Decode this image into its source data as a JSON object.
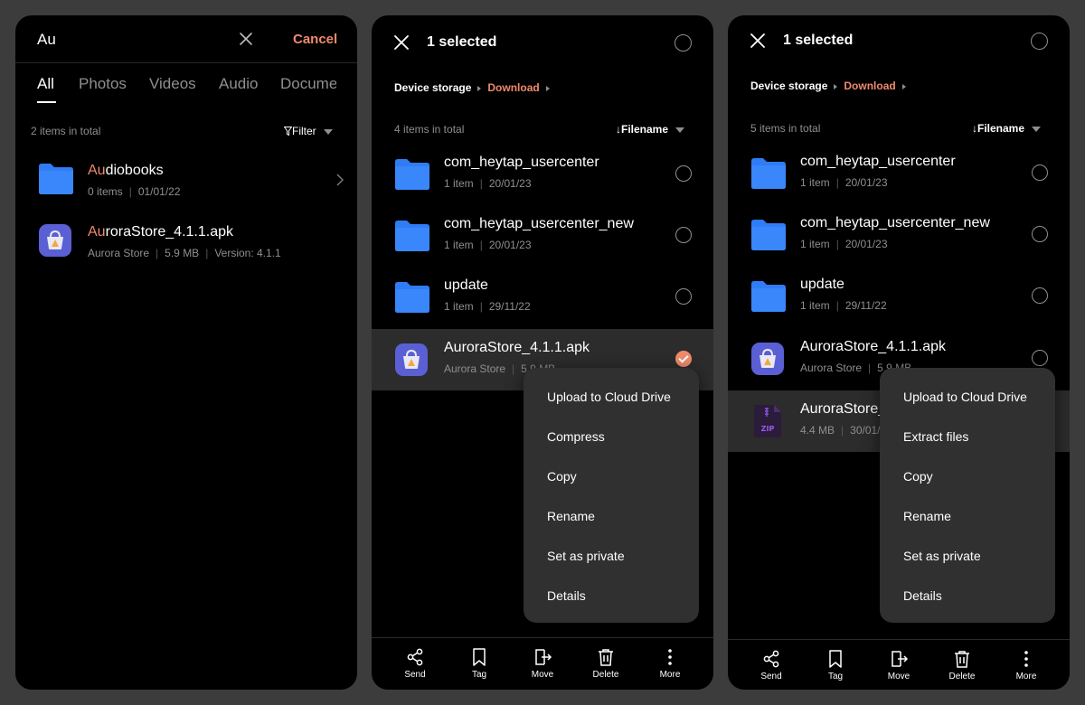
{
  "search_panel": {
    "query": "Au",
    "cancel_label": "Cancel",
    "tabs": [
      "All",
      "Photos",
      "Videos",
      "Audio",
      "Docume"
    ],
    "active_tab": "All",
    "count": "2 items in total",
    "filter_label": "Filter",
    "items": [
      {
        "name_hl": "Au",
        "name_rest": "diobooks",
        "meta": [
          "0 items",
          "01/01/22"
        ],
        "icon": "folder-icon"
      },
      {
        "name_hl": "Au",
        "name_rest": "roraStore_4.1.1.apk",
        "meta": [
          "Aurora Store",
          "5.9 MB",
          "Version: 4.1.1"
        ],
        "icon": "aurora-store-app-icon"
      }
    ]
  },
  "select_panel_1": {
    "title": "1 selected",
    "breadcrumb": [
      "Device storage",
      "Download"
    ],
    "count": "4 items in total",
    "sort_label": "Filename",
    "items": [
      {
        "name": "com_heytap_usercenter",
        "meta": [
          "1 item",
          "20/01/23"
        ],
        "icon": "folder-icon",
        "checked": false
      },
      {
        "name": "com_heytap_usercenter_new",
        "meta": [
          "1 item",
          "20/01/23"
        ],
        "icon": "folder-icon",
        "checked": false
      },
      {
        "name": "update",
        "meta": [
          "1 item",
          "29/11/22"
        ],
        "icon": "folder-icon",
        "checked": false
      },
      {
        "name": "AuroraStore_4.1.1.apk",
        "meta": [
          "Aurora Store",
          "5.9 MB"
        ],
        "icon": "aurora-store-app-icon",
        "checked": true
      }
    ],
    "menu": [
      "Upload to Cloud Drive",
      "Compress",
      "Copy",
      "Rename",
      "Set as private",
      "Details"
    ]
  },
  "select_panel_2": {
    "title": "1 selected",
    "breadcrumb": [
      "Device storage",
      "Download"
    ],
    "count": "5 items in total",
    "sort_label": "Filename",
    "items": [
      {
        "name": "com_heytap_usercenter",
        "meta": [
          "1 item",
          "20/01/23"
        ],
        "icon": "folder-icon",
        "checked": false
      },
      {
        "name": "com_heytap_usercenter_new",
        "meta": [
          "1 item",
          "20/01/23"
        ],
        "icon": "folder-icon",
        "checked": false
      },
      {
        "name": "update",
        "meta": [
          "1 item",
          "29/11/22"
        ],
        "icon": "folder-icon",
        "checked": false
      },
      {
        "name": "AuroraStore_4.1.1.apk",
        "meta": [
          "Aurora Store",
          "5.9 MB"
        ],
        "icon": "aurora-store-app-icon",
        "checked": false
      },
      {
        "name": "AuroraStore_4.1.1.zip",
        "meta": [
          "4.4 MB",
          "30/01/23"
        ],
        "icon": "zip-file-icon",
        "checked": true
      }
    ],
    "menu": [
      "Upload to Cloud Drive",
      "Extract files",
      "Copy",
      "Rename",
      "Set as private",
      "Details"
    ]
  },
  "toolbar": {
    "send": "Send",
    "tag": "Tag",
    "move": "Move",
    "delete": "Delete",
    "more": "More"
  },
  "colors": {
    "accent": "#f08a6c",
    "folder": "#2f7cf6",
    "panel_bg": "#000000",
    "menu_bg": "#303030",
    "selected_row": "#2c2c2c",
    "page_bg": "#3c3c3c"
  }
}
